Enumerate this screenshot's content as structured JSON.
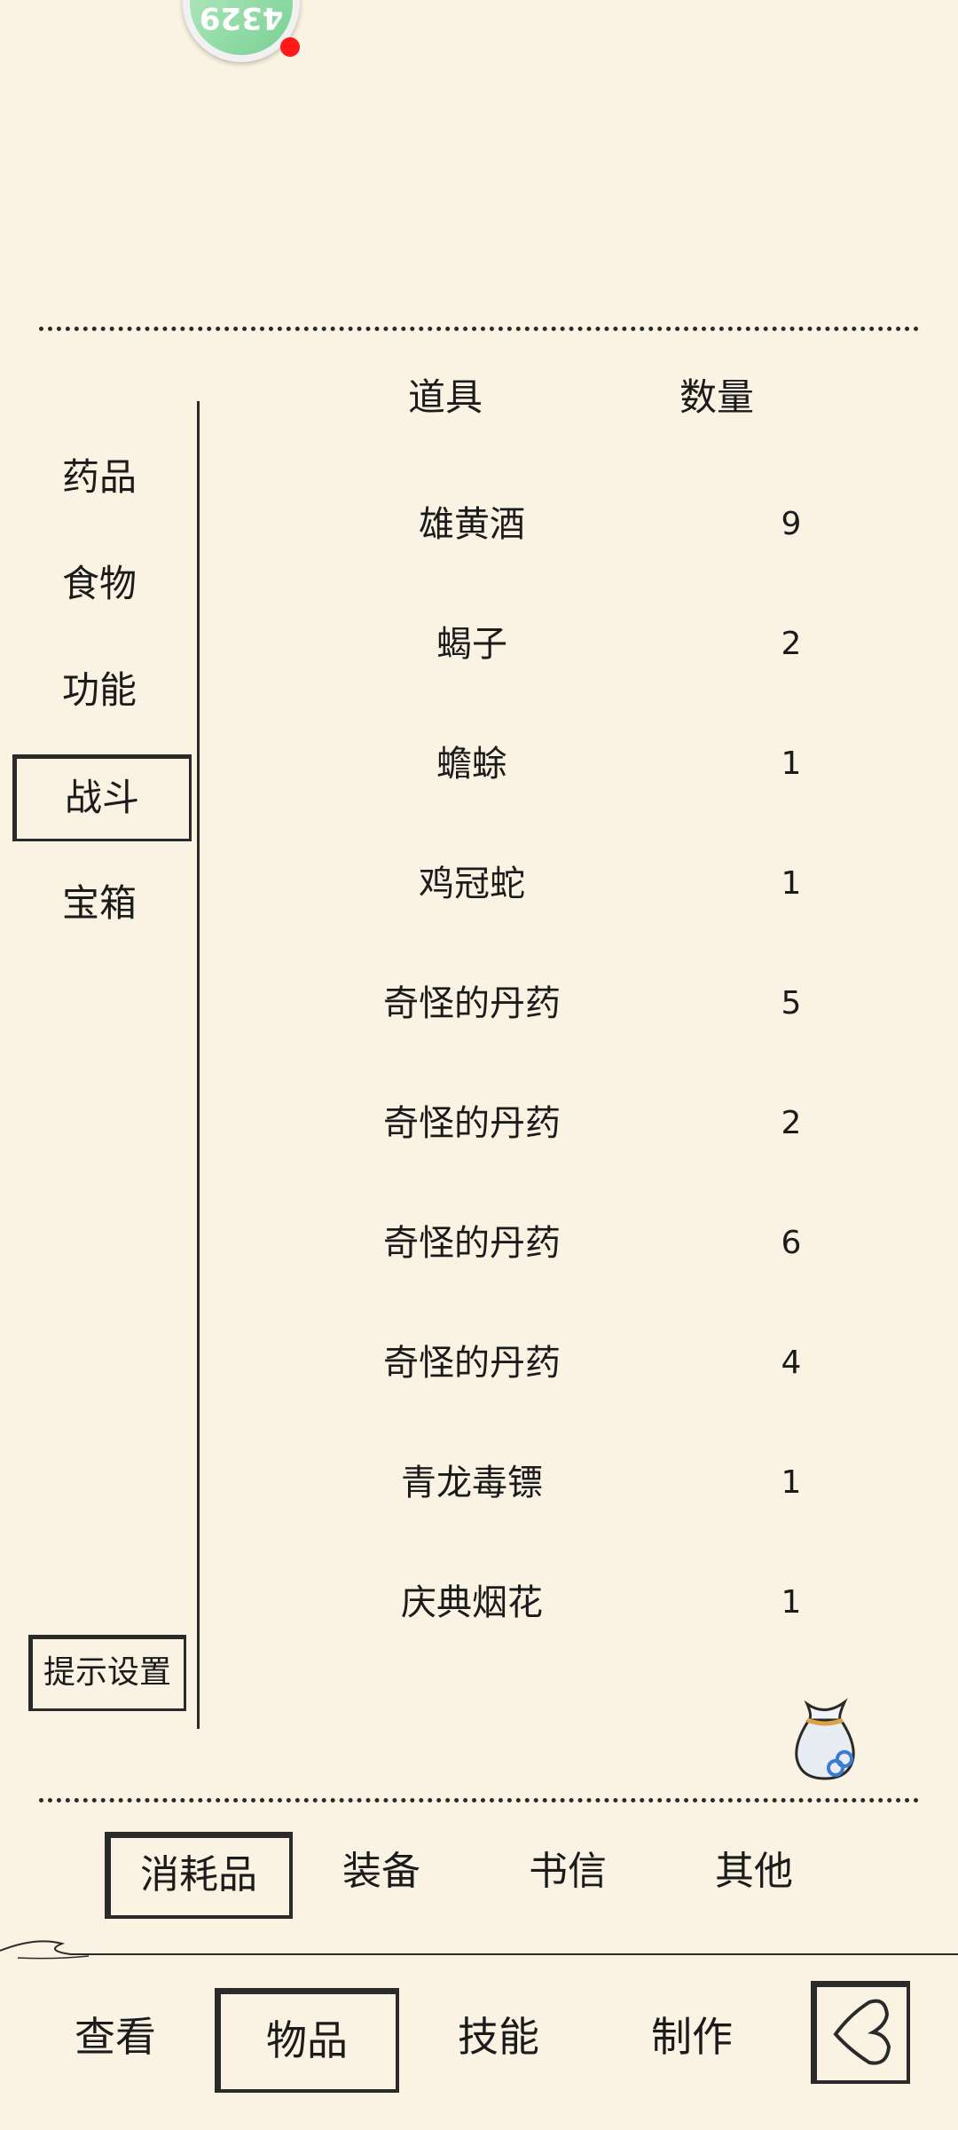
{
  "badge": {
    "text": "4329"
  },
  "table": {
    "col_item": "道具",
    "col_count": "数量"
  },
  "categories": [
    {
      "label": "药品"
    },
    {
      "label": "食物"
    },
    {
      "label": "功能"
    },
    {
      "label": "战斗",
      "active": true
    },
    {
      "label": "宝箱"
    }
  ],
  "items": [
    {
      "name": "雄黄酒",
      "count": "9"
    },
    {
      "name": "蝎子",
      "count": "2"
    },
    {
      "name": "蟾蜍",
      "count": "1"
    },
    {
      "name": "鸡冠蛇",
      "count": "1"
    },
    {
      "name": "奇怪的丹药",
      "count": "5"
    },
    {
      "name": "奇怪的丹药",
      "count": "2"
    },
    {
      "name": "奇怪的丹药",
      "count": "6"
    },
    {
      "name": "奇怪的丹药",
      "count": "4"
    },
    {
      "name": "青龙毒镖",
      "count": "1"
    },
    {
      "name": "庆典烟花",
      "count": "1"
    }
  ],
  "hint_settings": "提示设置",
  "sub_tabs": [
    {
      "label": "消耗品",
      "active": true
    },
    {
      "label": "装备"
    },
    {
      "label": "书信"
    },
    {
      "label": "其他"
    }
  ],
  "nav_tabs": [
    {
      "label": "查看"
    },
    {
      "label": "物品",
      "active": true
    },
    {
      "label": "技能"
    },
    {
      "label": "制作"
    }
  ],
  "icons": {
    "bag": "money-bag-icon",
    "back": "back-arrow-icon"
  },
  "colors": {
    "background": "#faf3e3",
    "ink": "#1b1b1b",
    "badge_green": "#8bd8a0",
    "notify_red": "#ff1a1a"
  }
}
